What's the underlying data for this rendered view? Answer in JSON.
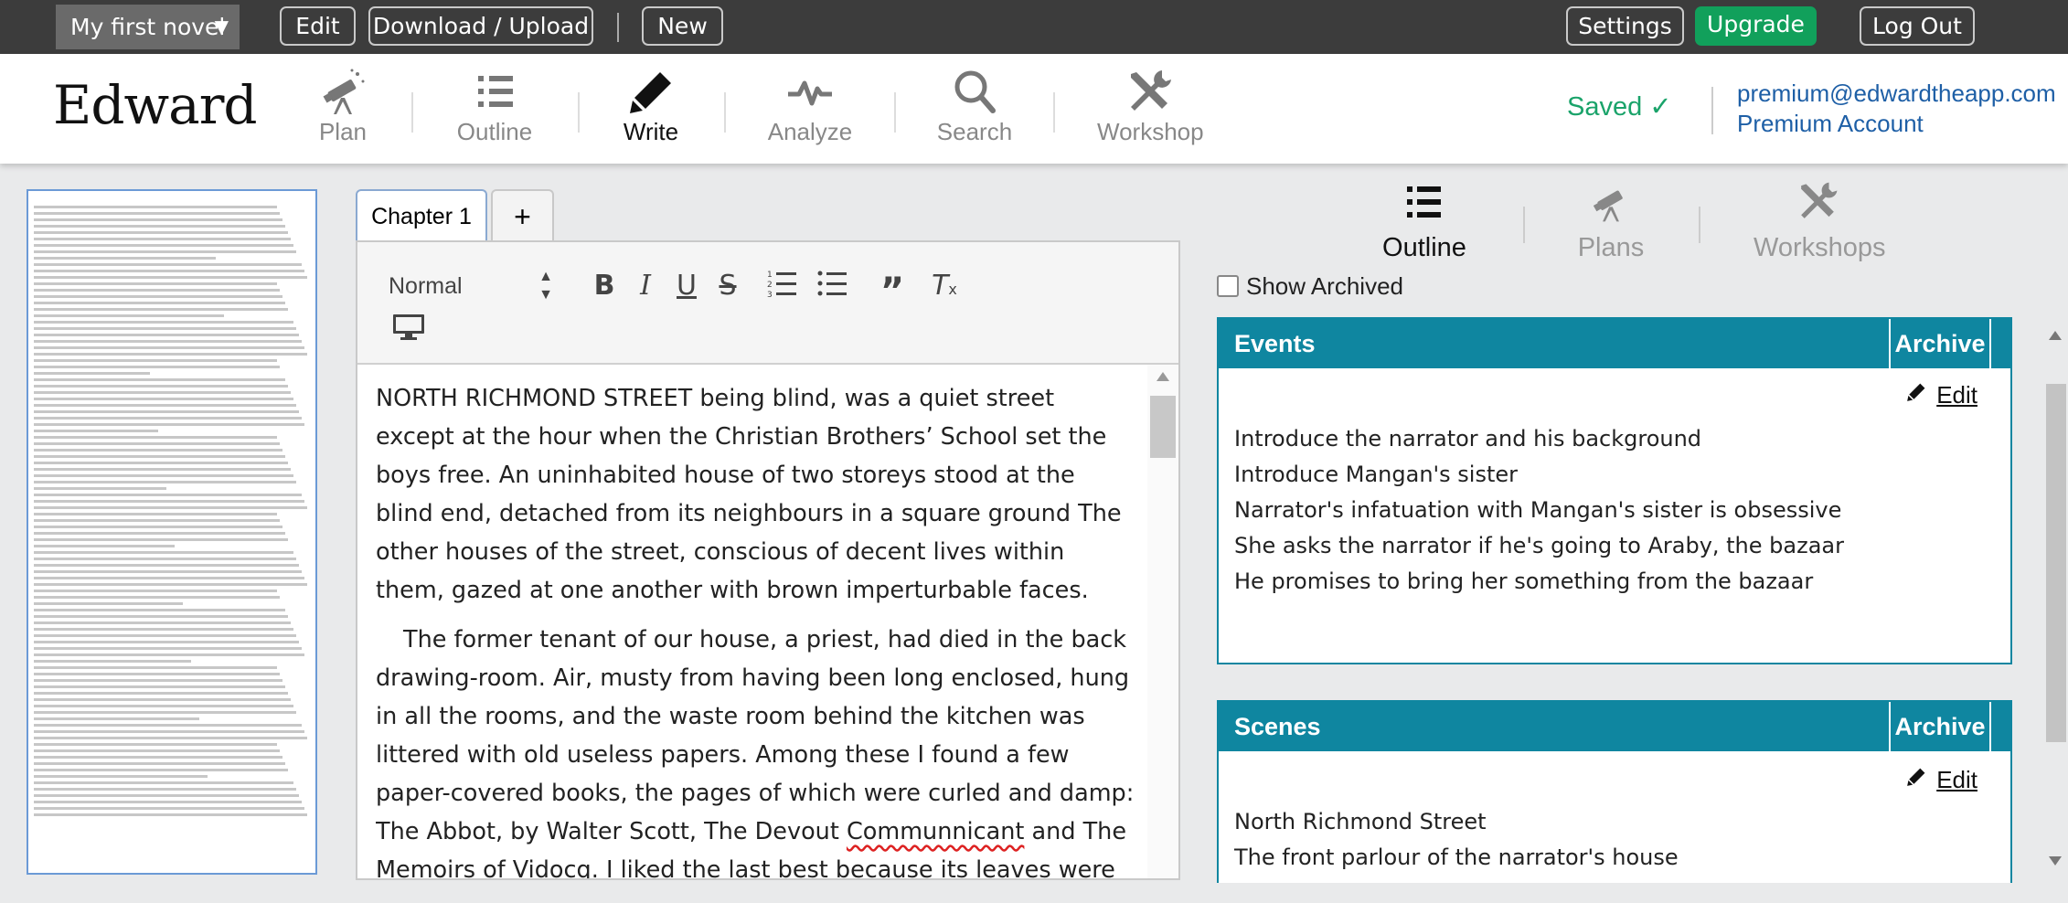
{
  "topbar": {
    "novel_title": "My first novel",
    "edit_label": "Edit",
    "download_label": "Download / Upload",
    "new_label": "New",
    "settings_label": "Settings",
    "upgrade_label": "Upgrade",
    "logout_label": "Log Out"
  },
  "header": {
    "logo": "Edward",
    "nav": [
      "Plan",
      "Outline",
      "Write",
      "Analyze",
      "Search",
      "Workshop"
    ],
    "active_nav": "Write",
    "saved_label": "Saved ✓",
    "account_email": "premium@edwardtheapp.com",
    "account_type": "Premium Account"
  },
  "editor": {
    "tabs": [
      "Chapter 1"
    ],
    "add_tab": "+",
    "format_select": "Normal",
    "paragraphs": [
      "NORTH RICHMOND STREET being blind, was a quiet street except at the hour when the Christian Brothers’ School set the boys free. An uninhabited house of two storeys stood at the blind end, detached from its neighbours in a square ground The other houses of the street, conscious of decent lives within them, gazed at one another with brown imperturbable faces.",
      "The former tenant of our house, a priest, had died in the back drawing-room. Air, musty from having been long enclosed, hung in all the rooms, and the waste room behind the kitchen was littered with old useless papers. Among these I found a few paper-covered books, the pages of which were curled and damp: The Abbot, by Walter Scott, The Devout ",
      "Communnicant",
      " and The Memoirs of Vidocq. I liked the last best because its leaves were yellow. The wild"
    ]
  },
  "panel": {
    "tabs": [
      "Outline",
      "Plans",
      "Workshops"
    ],
    "active_tab": "Outline",
    "show_archived_label": "Show Archived",
    "events": {
      "title": "Events",
      "archive_label": "Archive",
      "edit_label": "Edit",
      "items": [
        "Introduce the narrator and his background",
        "Introduce Mangan's sister",
        "Narrator's infatuation with Mangan's sister is obsessive",
        "She asks the narrator if he's going to Araby, the bazaar",
        "He promises to bring her something from the bazaar"
      ]
    },
    "scenes": {
      "title": "Scenes",
      "archive_label": "Archive",
      "edit_label": "Edit",
      "items": [
        "North Richmond Street",
        "The front parlour of the narrator's house"
      ]
    }
  },
  "colors": {
    "topbar": "#3c3c3c",
    "upgrade": "#11a05b",
    "card_header": "#0f86a0",
    "saved": "#1aa36a",
    "link": "#1e5fa6"
  }
}
